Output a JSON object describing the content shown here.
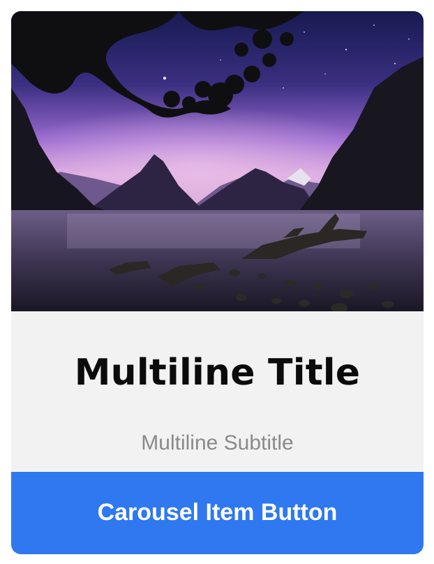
{
  "card": {
    "image": {
      "alt_semantic": "hero-image"
    },
    "title": "Multiline Title",
    "subtitle": "Multiline Subtitle",
    "button_label": "Carousel Item Button"
  },
  "colors": {
    "card_body_bg": "#f2f2f2",
    "title_text": "#0b0b0b",
    "subtitle_text": "#8a8a8a",
    "button_bg": "#2f78f0",
    "button_text": "#ffffff"
  }
}
